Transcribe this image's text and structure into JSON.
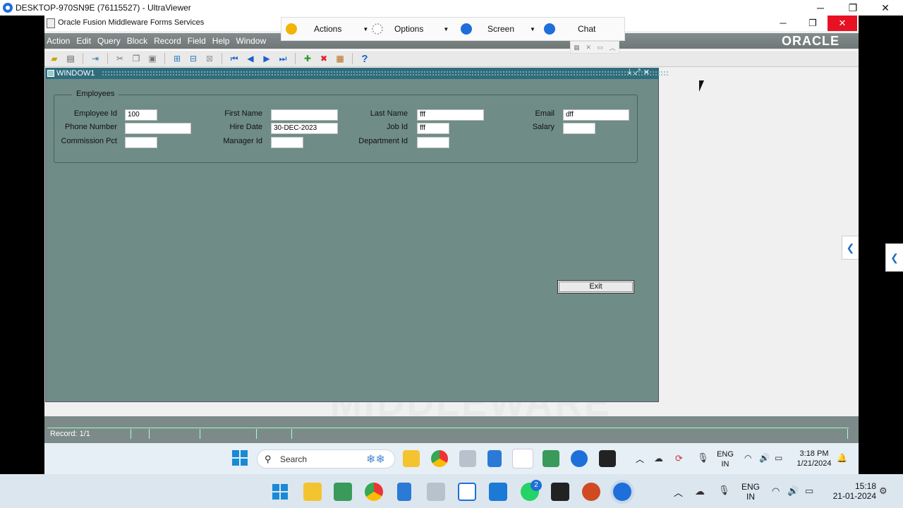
{
  "viewer": {
    "title": "DESKTOP-970SN9E (76115527) - UltraViewer",
    "controls": {
      "minimize": "─",
      "restore": "❐",
      "close": "✕"
    },
    "toolbar": {
      "actions": "Actions",
      "options": "Options",
      "screen": "Screen",
      "chat": "Chat"
    }
  },
  "applet": {
    "title": "Oracle Fusion Middleware Forms Services",
    "controls": {
      "minimize": "─",
      "restore": "❐",
      "close": "✕"
    }
  },
  "forms": {
    "menu": [
      "Action",
      "Edit",
      "Query",
      "Block",
      "Record",
      "Field",
      "Help",
      "Window"
    ],
    "logo": "ORACLE",
    "watermark": "MIDDLEWARE",
    "window": {
      "title": "WINDOW1",
      "frame_title": "Employees",
      "fields": {
        "employee_id": {
          "label": "Employee Id",
          "value": "100"
        },
        "first_name": {
          "label": "First Name",
          "value": ""
        },
        "last_name": {
          "label": "Last Name",
          "value": "fff"
        },
        "email": {
          "label": "Email",
          "value": "dff"
        },
        "phone_number": {
          "label": "Phone Number",
          "value": ""
        },
        "hire_date": {
          "label": "Hire Date",
          "value": "30-DEC-2023"
        },
        "job_id": {
          "label": "Job Id",
          "value": "fff"
        },
        "salary": {
          "label": "Salary",
          "value": ""
        },
        "commission_pct": {
          "label": "Commission Pct",
          "value": ""
        },
        "manager_id": {
          "label": "Manager Id",
          "value": ""
        },
        "department_id": {
          "label": "Department Id",
          "value": ""
        }
      },
      "exit_label": "Exit"
    },
    "status": {
      "record": "Record: 1/1"
    }
  },
  "remote_taskbar": {
    "search_placeholder": "Search",
    "lang_line1": "ENG",
    "lang_line2": "IN",
    "time": "3:18 PM",
    "date": "1/21/2024"
  },
  "local_taskbar": {
    "whatsapp_badge": "2",
    "lang_line1": "ENG",
    "lang_line2": "IN",
    "time": "15:18",
    "date": "21-01-2024"
  }
}
